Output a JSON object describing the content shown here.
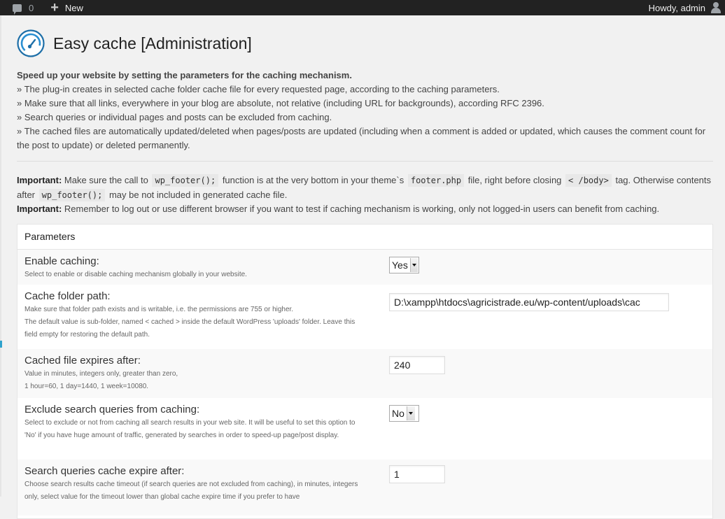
{
  "adminbar": {
    "comments_count": "0",
    "new_label": "New",
    "greeting": "Howdy, admin"
  },
  "page": {
    "title": "Easy cache [Administration]"
  },
  "intro": {
    "headline": "Speed up your website by setting the parameters for the caching mechanism.",
    "lines": [
      "» The plug-in creates in selected cache folder cache file for every requested page, according to the caching parameters.",
      "» Make sure that all links, everywhere in your blog are absolute, not relative (including URL for backgrounds), according RFC 2396.",
      "» Search queries or individual pages and posts can be excluded from caching.",
      "» The cached files are automatically updated/deleted when pages/posts are updated (including when a comment is added or updated, which causes the comment count for the post to update) or deleted permanently."
    ]
  },
  "important": {
    "label": "Important:",
    "p1_a": "Make sure the call to",
    "code1": "wp_footer();",
    "p1_b": "function is at the very bottom in your theme`s",
    "code2": "footer.php",
    "p1_c": "file, right before closing",
    "code3": "< /body>",
    "p1_d": "tag. Otherwise contents after",
    "code4": "wp_footer();",
    "p1_e": "may be not included in generated cache file.",
    "label2": "Important:",
    "p2": "Remember to log out or use different browser if you want to test if caching mechanism is working, only not logged-in users can benefit from caching."
  },
  "params": {
    "heading": "Parameters",
    "rows": [
      {
        "label": "Enable caching:",
        "desc": [
          "Select to enable or disable caching mechanism globally in your website."
        ],
        "control": "select",
        "value": "Yes"
      },
      {
        "label": "Cache folder path:",
        "desc": [
          "Make sure that folder path exists and is writable, i.e. the permissions are 755 or higher.",
          "The default value is sub-folder, named < cached > inside the default WordPress 'uploads' folder. Leave this field empty for restoring the default path."
        ],
        "control": "text",
        "value": "D:\\xampp\\htdocs\\agricistrade.eu/wp-content/uploads\\cac"
      },
      {
        "label": "Cached file expires after:",
        "desc": [
          "Value in minutes, integers only, greater than zero,",
          "1 hour=60, 1 day=1440, 1 week=10080."
        ],
        "control": "text",
        "value": "240"
      },
      {
        "label": "Exclude search queries from caching:",
        "desc": [
          "Select to exclude or not from caching all search results in your web site. It will be useful to set this option to 'No' if you have huge amount of traffic, generated by searches in order to speed-up page/post display."
        ],
        "control": "select",
        "value": "No"
      },
      {
        "label": "Search queries cache expire after:",
        "desc": [
          "Choose search results cache timeout (if search queries are not excluded from caching), in minutes, integers only, select value for the timeout lower than global cache expire time if you prefer to have"
        ],
        "control": "text",
        "value": "1"
      }
    ]
  }
}
